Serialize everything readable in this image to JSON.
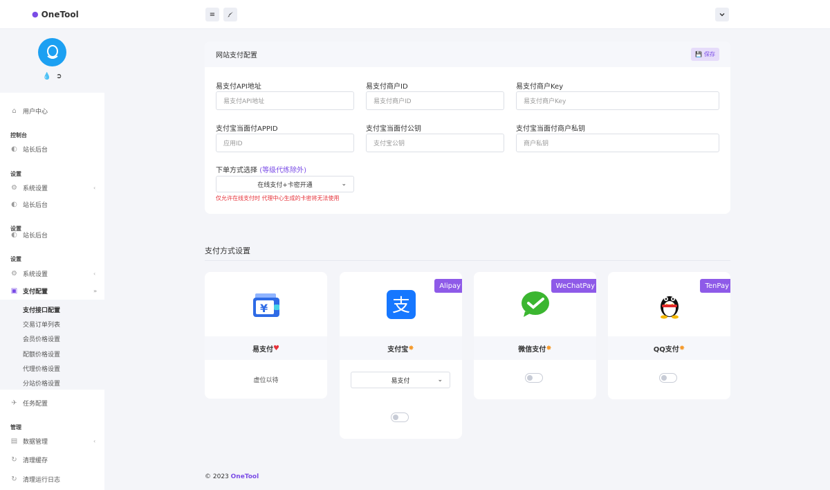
{
  "app": {
    "name": "OneTool"
  },
  "topbar": {
    "menu_icon": "≡",
    "brush_icon": "brush-icon",
    "dropdown_icon": "chevron-down-icon"
  },
  "sidebar": {
    "user_center": "用户中心",
    "groups": [
      {
        "heading": "控制台",
        "items": [
          {
            "label": "站长后台"
          }
        ]
      },
      {
        "heading": "设置",
        "items": [
          {
            "label": "系统设置"
          },
          {
            "label": "站长后台"
          }
        ]
      },
      {
        "heading": "设置",
        "items": [
          {
            "label": "站长后台"
          }
        ]
      },
      {
        "heading": "设置",
        "items": [
          {
            "label": "系统设置"
          },
          {
            "label": "支付配置"
          }
        ]
      }
    ],
    "submenu": [
      "支付接口配置",
      "交易订单列表",
      "会员价格设置",
      "配额价格设置",
      "代理价格设置",
      "分站价格设置"
    ],
    "task_config": "任务配置",
    "manage_heading": "管理",
    "manage_items": [
      "数据管理",
      "清理缓存",
      "清理运行日志"
    ]
  },
  "config_card": {
    "title": "网站支付配置",
    "save_label": "保存",
    "fields": [
      {
        "label": "易支付API地址",
        "placeholder": "易支付API地址"
      },
      {
        "label": "易支付商户ID",
        "placeholder": "易支付商户ID"
      },
      {
        "label": "易支付商户Key",
        "placeholder": "易支付商户Key"
      },
      {
        "label": "支付宝当面付APPID",
        "placeholder": "应用ID"
      },
      {
        "label": "支付宝当面付公钥",
        "placeholder": "支付宝公钥"
      },
      {
        "label": "支付宝当面付商户私钥",
        "placeholder": "商户私钥"
      }
    ],
    "order_mode_label": "下单方式选择",
    "order_mode_hint": "(等级代练除外)",
    "order_mode_value": "在线支付+卡密开通",
    "warning": "仅允许在线支付时 代理中心生成的卡密将无法使用"
  },
  "payment_section": {
    "title": "支付方式设置",
    "cards": [
      {
        "name": "易支付",
        "badge": "",
        "mark": "♥",
        "body_text": "虚位以待"
      },
      {
        "name": "支付宝",
        "badge": "Alipay",
        "mark": "✸",
        "select_value": "易支付",
        "toggle_on": false
      },
      {
        "name": "微信支付",
        "badge": "WeChatPay",
        "mark": "✸",
        "toggle_on": false
      },
      {
        "name": "QQ支付",
        "badge": "TenPay",
        "mark": "✸",
        "toggle_on": false
      }
    ]
  },
  "footer": {
    "copyright": "© 2023",
    "brand": "OneTool"
  },
  "colors": {
    "accent": "#7a4ce6",
    "badge": "#8e5ae8",
    "warning": "#e6333b",
    "alipay": "#1677ff",
    "wechat": "#3bb630"
  }
}
